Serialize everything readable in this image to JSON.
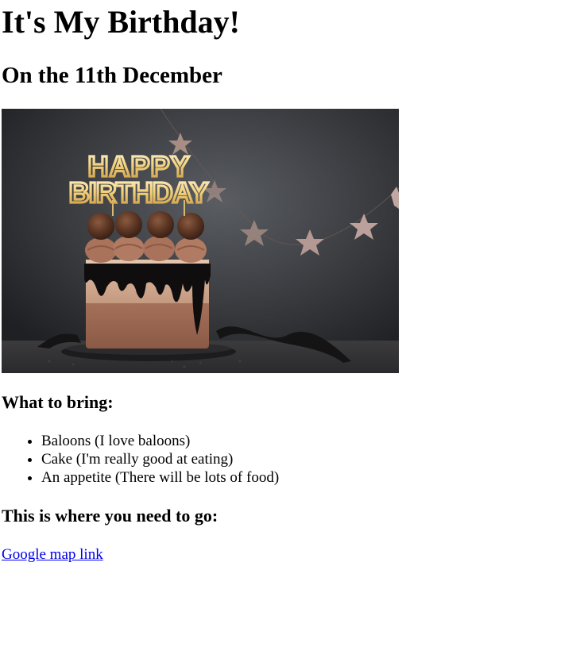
{
  "page": {
    "title": "It's My Birthday!",
    "subtitle": "On the 11th December"
  },
  "image": {
    "alt_text": "HAPPY BIRTHDAY",
    "topper_line1": "HAPPY",
    "topper_line2": "BIRTHDAY"
  },
  "bring": {
    "heading": "What to bring:",
    "items": [
      "Baloons (I love baloons)",
      "Cake (I'm really good at eating)",
      "An appetite (There will be lots of food)"
    ]
  },
  "location": {
    "heading": "This is where you need to go:",
    "link_text": "Google map link"
  },
  "colors": {
    "link": "#0000ee",
    "text": "#000000",
    "background": "#ffffff"
  }
}
